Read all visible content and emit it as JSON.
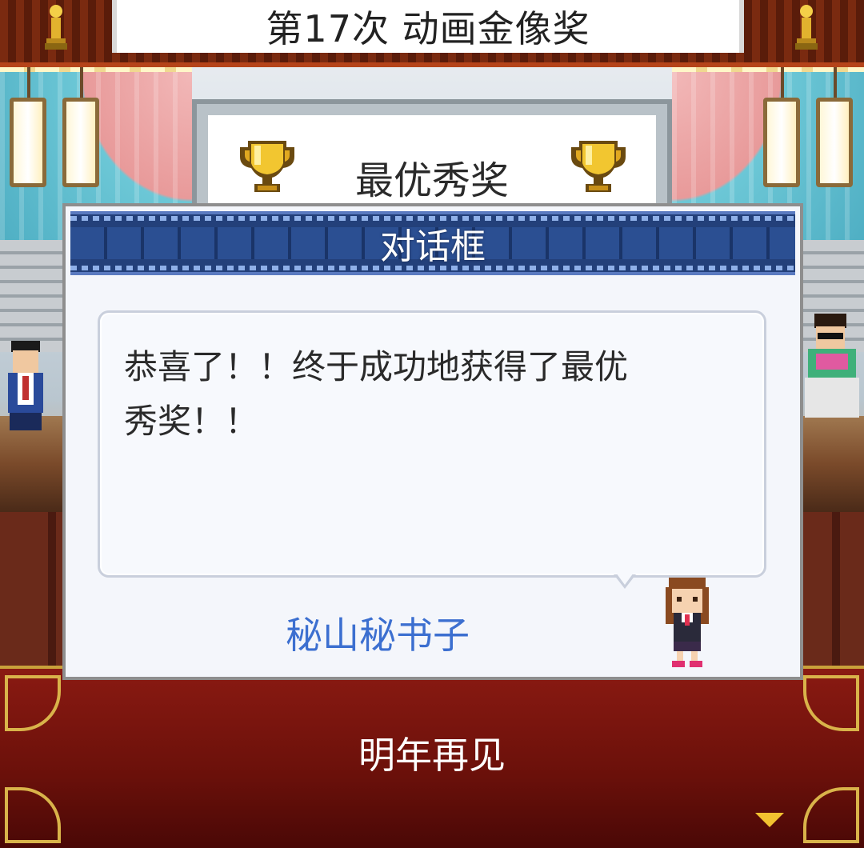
{
  "event": {
    "title": "第17次 动画金像奖"
  },
  "award": {
    "name": "最优秀奖"
  },
  "dialog": {
    "header": "对话框",
    "message": "恭喜了！！终于成功地获得了最优\n秀奖！！",
    "speaker": "秘山秘书子"
  },
  "actions": {
    "next_label": "明年再见"
  },
  "colors": {
    "dialog_header": "#23407a",
    "speaker_name": "#3c6fd0",
    "bottom_panel": "#7a1410",
    "gold": "#d9b34a"
  },
  "icons": [
    "trophy-icon",
    "statuette-icon",
    "advance-arrow-icon"
  ]
}
